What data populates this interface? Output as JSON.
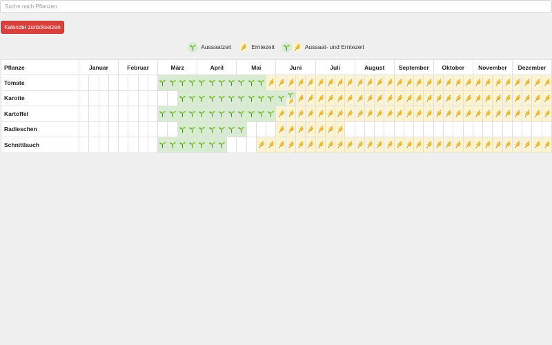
{
  "search": {
    "placeholder": "Suche nach Pflanzen",
    "value": ""
  },
  "reset_button": {
    "label": "Kalender zurücksetzen"
  },
  "legend": [
    {
      "kind": "sow",
      "label": "Aussaatzeit"
    },
    {
      "kind": "harvest",
      "label": "Erntezeit"
    },
    {
      "kind": "both",
      "label": "Aussaat- und Erntezeit"
    }
  ],
  "table": {
    "plant_header": "Pflanze",
    "months": [
      "Januar",
      "Februar",
      "März",
      "April",
      "Mai",
      "Juni",
      "Juli",
      "August",
      "September",
      "Oktober",
      "November",
      "Dezember"
    ],
    "rows": [
      {
        "name": "Tomate",
        "cells": "________SSSSSSSSSSSHHHHHHHHHHHHHHHHHHHHHHHHHHHHHHHHHHHHHHHHHHHHHHH__________"
      },
      {
        "name": "Karotte",
        "cells": "__________SSSSSSSSSSSBHHHHHHHHHHHHHHHHHHHHHHHHHHHHHHHHHHHHHHHHHHHHHHHHHHHHHHHHH"
      },
      {
        "name": "Kartoffel",
        "cells": "________SSSSSSSSSSSSHHHHHHHHHHHHHHHHHHHHHHHHHHHHHHHHHHHHHHHHHHHHHHHHHH__________"
      },
      {
        "name": "Radieschen",
        "cells": "__________SSSSSSS___HHHHHHH_____________________________________________________"
      },
      {
        "name": "Schnittlauch",
        "cells": "________SSSSSSS___HHHHHHHHHHHHHHHHHHHHHHHHHHHHHHHHHH____________________________"
      }
    ]
  },
  "colors": {
    "sow_bg": "#d8ecd2",
    "harvest_bg": "#fbf3d2",
    "button": "#d9403c"
  },
  "icons": {
    "sow": "seedling-icon",
    "harvest": "wheat-icon"
  }
}
